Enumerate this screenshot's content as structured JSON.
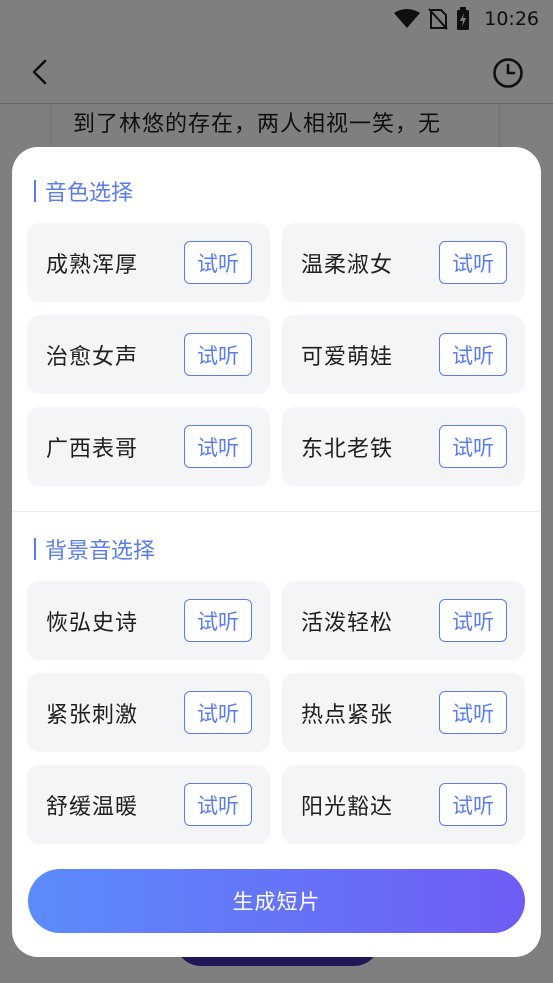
{
  "status_bar": {
    "time": "10:26",
    "icons": [
      "wifi-icon",
      "no-sim-icon",
      "battery-charging-icon"
    ]
  },
  "header": {
    "back_icon": "chevron-left-icon",
    "history_icon": "clock-icon"
  },
  "story": {
    "text": "到了林悠的存在，两人相视一笑，无"
  },
  "sheet": {
    "voice_section": {
      "title": "音色选择",
      "options": [
        {
          "label": "成熟浑厚",
          "button": "试听"
        },
        {
          "label": "温柔淑女",
          "button": "试听"
        },
        {
          "label": "治愈女声",
          "button": "试听"
        },
        {
          "label": "可爱萌娃",
          "button": "试听"
        },
        {
          "label": "广西表哥",
          "button": "试听"
        },
        {
          "label": "东北老铁",
          "button": "试听"
        }
      ]
    },
    "bgm_section": {
      "title": "背景音选择",
      "options": [
        {
          "label": "恢弘史诗",
          "button": "试听"
        },
        {
          "label": "活泼轻松",
          "button": "试听"
        },
        {
          "label": "紧张刺激",
          "button": "试听"
        },
        {
          "label": "热点紧张",
          "button": "试听"
        },
        {
          "label": "舒缓温暖",
          "button": "试听"
        },
        {
          "label": "阳光豁达",
          "button": "试听"
        }
      ]
    },
    "generate_button": "生成短片"
  },
  "colors": {
    "accent": "#5b7cf0",
    "gradient_start": "#5b8cfa",
    "gradient_end": "#6f5cf6",
    "card_bg": "#f4f5f7"
  }
}
